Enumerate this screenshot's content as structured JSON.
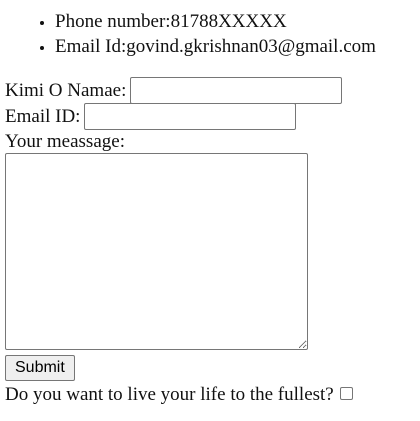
{
  "contact_info": {
    "items": [
      {
        "label": "Phone number:",
        "value": "81788XXXXX"
      },
      {
        "label": "Email Id:",
        "value": "govind.gkrishnan03@gmail.com"
      }
    ]
  },
  "form": {
    "name_label": "Kimi O Namae:",
    "name_value": "",
    "email_label": "Email ID:",
    "email_value": "",
    "message_label": "Your meassage:",
    "message_value": "",
    "submit_label": "Submit",
    "question_label": "Do you want to live your life to the fullest?",
    "question_checked": false
  }
}
